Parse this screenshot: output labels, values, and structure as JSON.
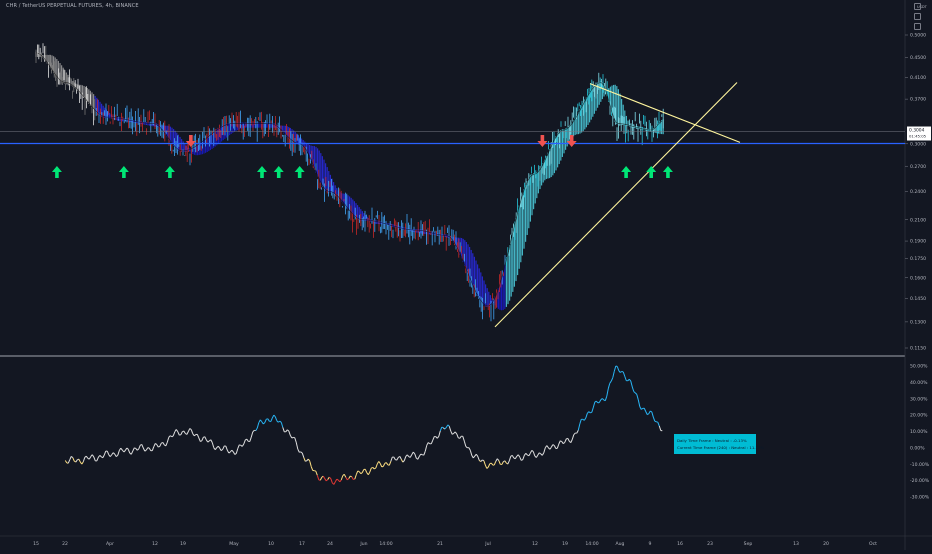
{
  "header": {
    "title": "CHR / TetherUS PERPETUAL FUTURES, 4h, BINANCE"
  },
  "price_axis": {
    "ticks": [
      "0.5000",
      "0.4500",
      "0.4100",
      "0.3700",
      "0.3000",
      "0.2700",
      "0.2400",
      "0.2100",
      "0.1900",
      "0.1750",
      "0.1600",
      "0.1450",
      "0.1300",
      "0.1150"
    ]
  },
  "price_label": {
    "value": "0.3004",
    "sub": "01:45:05"
  },
  "osc_axis": {
    "ticks": [
      "50.00%",
      "40.00%",
      "30.00%",
      "20.00%",
      "10.00%",
      "0.00%",
      "-10.00%",
      "-20.00%",
      "-30.00%"
    ]
  },
  "info_box": {
    "line1": "Daily Time Frame : Neutral : -0.13%",
    "line2": "Current Time Frame (240) : Neutral : 11.30%",
    "color": "#00bcd4"
  },
  "time_axis": {
    "labels": [
      "15",
      "22",
      "Apr",
      "12",
      "19",
      "May",
      "10",
      "17",
      "24",
      "Jun",
      "14:00",
      "21",
      "Jul",
      "12",
      "19",
      "14:00",
      "Aug",
      "9",
      "16",
      "23",
      "Sep",
      "13",
      "20",
      "Oct"
    ]
  },
  "colors": {
    "background": "#131722",
    "horizontal_line": "#2962ff",
    "trendline": "#fff59d",
    "arrow_up": "#00e676",
    "arrow_down": "#ef5350",
    "ribbon_blue": "#1a1ad0",
    "ribbon_cyan": "#4dd0e1"
  },
  "chart_data": [
    {
      "type": "line",
      "title": "CHR / TetherUS PERPETUAL FUTURES, 4h, BINANCE",
      "y_scale": "log",
      "ylim": [
        0.115,
        0.5
      ],
      "x": [
        "Mar 15",
        "Mar 22",
        "Apr 1",
        "Apr 12",
        "Apr 19",
        "May 1",
        "May 10",
        "May 17",
        "May 24",
        "Jun 1",
        "Jun 14",
        "Jun 21",
        "Jul 1",
        "Jul 12",
        "Jul 19",
        "Jul 28",
        "Aug 1",
        "Aug 9",
        "Aug 12"
      ],
      "series": [
        {
          "values": [
            0.46,
            0.4,
            0.34,
            0.33,
            0.29,
            0.33,
            0.33,
            0.3,
            0.24,
            0.21,
            0.2,
            0.195,
            0.14,
            0.26,
            0.32,
            0.4,
            0.33,
            0.32,
            0.335
          ]
        }
      ],
      "horizontal_line": 0.3004,
      "signals_up": [
        "Mar 20",
        "Apr 5",
        "Apr 16",
        "May 8",
        "May 12",
        "May 17",
        "Aug 3",
        "Aug 9",
        "Aug 13"
      ],
      "signals_down": [
        "Apr 21",
        "Jul 14",
        "Jul 21"
      ],
      "grid": false
    },
    {
      "type": "line",
      "ylim": [
        -30,
        50
      ],
      "x": [
        "Mar 22",
        "Apr 12",
        "Apr 19",
        "May 1",
        "May 10",
        "May 24",
        "Jun 14",
        "Jun 21",
        "Jul 1",
        "Jul 12",
        "Jul 19",
        "Jul 28",
        "Aug 1",
        "Aug 9",
        "Aug 12"
      ],
      "series": [
        {
          "values": [
            -8,
            0,
            10,
            -2,
            18,
            -20,
            -5,
            12,
            -10,
            -4,
            3,
            28,
            48,
            20,
            11.3
          ]
        }
      ],
      "grid": false
    }
  ]
}
